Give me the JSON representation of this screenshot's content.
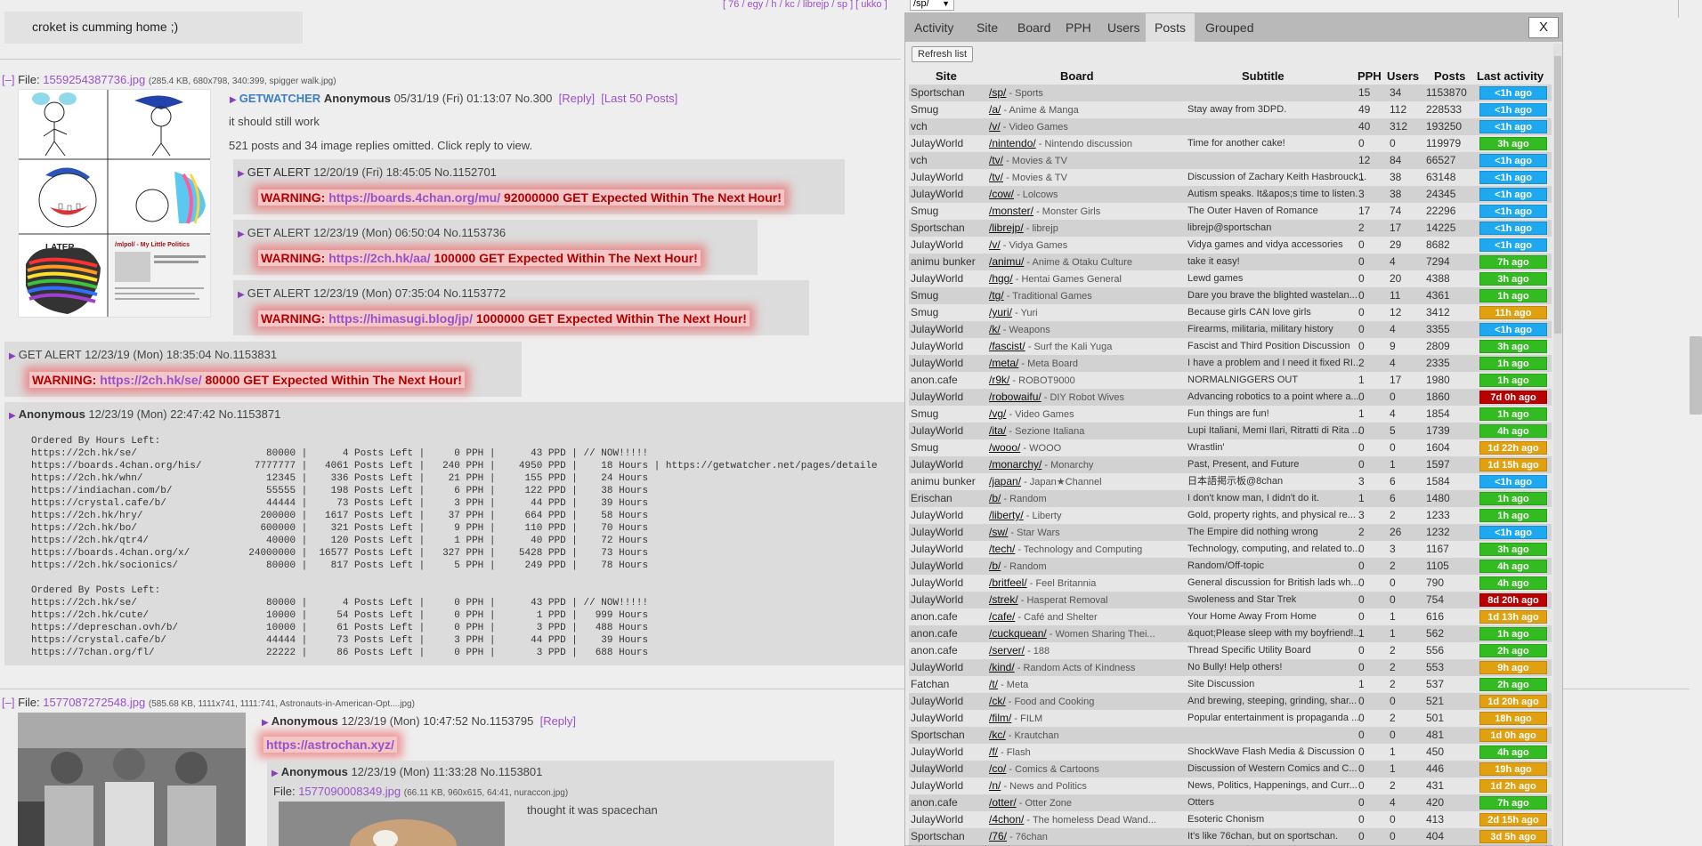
{
  "topnav": {
    "links": "[ 76 / egy / h / kc / librejp / sp ] [ ukko ]",
    "board_select": "/sp/"
  },
  "greybar_text": "croket is cumming home ;)",
  "thread1": {
    "toggle": "[–]",
    "file_label": "File:",
    "file_name": "1559254387736.jpg",
    "file_meta": "(285.4 KB, 680x798, 340:399, spigger walk.jpg)",
    "op_name": "GETWATCHER",
    "op_author": "Anonymous",
    "op_date": "05/31/19 (Fri) 01:13:07",
    "op_no": "No.300",
    "reply_link": "[Reply]",
    "last50_link": "[Last 50 Posts]",
    "op_text": "it should still work",
    "omitted": "521 posts and 34 image replies omitted. Click reply to view.",
    "thumb_caption_1": "LATER",
    "thumb_caption_2": "/mlpol/ - My Little Politics"
  },
  "alerts": [
    {
      "name": "GET ALERT",
      "date": "12/20/19 (Fri) 18:45:05",
      "no": "No.1152701",
      "prefix": "WARNING:",
      "url": "https://boards.4chan.org/mu/",
      "suffix": "92000000 GET Expected Within The Next Hour!"
    },
    {
      "name": "GET ALERT",
      "date": "12/23/19 (Mon) 06:50:04",
      "no": "No.1153736",
      "prefix": "WARNING:",
      "url": "https://2ch.hk/aa/",
      "suffix": "100000 GET Expected Within The Next Hour!"
    },
    {
      "name": "GET ALERT",
      "date": "12/23/19 (Mon) 07:35:04",
      "no": "No.1153772",
      "prefix": "WARNING:",
      "url": "https://himasugi.blog/jp/",
      "suffix": "1000000 GET Expected Within The Next Hour!"
    },
    {
      "name": "GET ALERT",
      "date": "12/23/19 (Mon) 18:35:04",
      "no": "No.1153831",
      "prefix": "WARNING:",
      "url": "https://2ch.hk/se/",
      "suffix": "80000 GET Expected Within The Next Hour!"
    }
  ],
  "anon_post": {
    "author": "Anonymous",
    "date": "12/23/19 (Mon) 22:47:42",
    "no": "No.1153871",
    "body": "Ordered By Hours Left:\nhttps://2ch.hk/se/                      80000 |      4 Posts Left |     0 PPH |      43 PPD | // NOW!!!!!\nhttps://boards.4chan.org/his/         7777777 |   4061 Posts Left |   240 PPH |    4950 PPD |    18 Hours | https://getwatcher.net/pages/detaile\nhttps://2ch.hk/whn/                     12345 |    336 Posts Left |    21 PPH |     155 PPD |    24 Hours\nhttps://indiachan.com/b/                55555 |    198 Posts Left |     6 PPH |     122 PPD |    38 Hours\nhttps://crystal.cafe/b/                 44444 |     73 Posts Left |     3 PPH |      44 PPD |    39 Hours\nhttps://2ch.hk/hry/                    200000 |   1617 Posts Left |    37 PPH |     664 PPD |    58 Hours\nhttps://2ch.hk/bo/                     600000 |    321 Posts Left |     9 PPH |     110 PPD |    70 Hours\nhttps://2ch.hk/qtr4/                    40000 |    120 Posts Left |     1 PPH |      40 PPD |    72 Hours\nhttps://boards.4chan.org/x/          24000000 |  16577 Posts Left |   327 PPH |    5428 PPD |    73 Hours\nhttps://2ch.hk/socionics/               80000 |    817 Posts Left |     5 PPH |     249 PPD |    78 Hours\n\nOrdered By Posts Left:\nhttps://2ch.hk/se/                      80000 |      4 Posts Left |     0 PPH |      43 PPD | // NOW!!!!!\nhttps://2ch.hk/cute/                    10000 |     54 Posts Left |     0 PPH |       1 PPD |   999 Hours\nhttps://depreschan.ovh/b/               10000 |     61 Posts Left |     0 PPH |       3 PPD |   488 Hours\nhttps://crystal.cafe/b/                 44444 |     73 Posts Left |     3 PPH |      44 PPD |    39 Hours\nhttps://7chan.org/fl/                   22222 |     86 Posts Left |     0 PPH |       3 PPD |   688 Hours"
  },
  "thread2": {
    "toggle": "[–]",
    "file_label": "File:",
    "file_name": "1577087272548.jpg",
    "file_meta": "(585.68 KB, 1111x741, 1111:741, Astronauts-in-American-Opt....jpg)",
    "op_author": "Anonymous",
    "op_date": "12/23/19 (Mon) 10:47:52",
    "op_no": "No.1153795",
    "reply_link": "[Reply]",
    "op_link": "https://astrochan.xyz/",
    "reply_author": "Anonymous",
    "reply_date": "12/23/19 (Mon) 11:33:28",
    "reply_no": "No.1153801",
    "reply_file_label": "File:",
    "reply_file": "1577090008349.jpg",
    "reply_file_meta": "(66.11 KB, 960x615, 64:41, nuraccon.jpg)",
    "reply_text": "thought it was spacechan"
  },
  "panel": {
    "tabs": [
      "Activity",
      "Site",
      "Board",
      "PPH",
      "Users",
      "Posts",
      "Grouped"
    ],
    "active_tab": "Posts",
    "close_label": "X",
    "refresh_label": "Refresh list",
    "columns": [
      "Site",
      "Board",
      "Subtitle",
      "PPH",
      "Users",
      "Posts",
      "Last activity"
    ],
    "activity_colors": {
      "cyan": "#1ea8f0",
      "green": "#33bb22",
      "orange": "#e0a010",
      "red": "#b80000"
    },
    "rows": [
      {
        "site": "Sportschan",
        "code": "/sp/",
        "name": " - Sports",
        "sub": "",
        "pph": "15",
        "users": "34",
        "posts": "1153870",
        "act": "<1h ago",
        "color": "cyan"
      },
      {
        "site": "Smug",
        "code": "/a/",
        "name": " - Anime & Manga",
        "sub": "Stay away from 3DPD.",
        "pph": "49",
        "users": "112",
        "posts": "228533",
        "act": "<1h ago",
        "color": "cyan"
      },
      {
        "site": "vch",
        "code": "/v/",
        "name": " - Video Games",
        "sub": "",
        "pph": "40",
        "users": "312",
        "posts": "193250",
        "act": "<1h ago",
        "color": "cyan"
      },
      {
        "site": "JulayWorld",
        "code": "/nintendo/",
        "name": " - Nintendo discussion",
        "sub": "Time for another cake!",
        "pph": "0",
        "users": "0",
        "posts": "119979",
        "act": "3h ago",
        "color": "green"
      },
      {
        "site": "vch",
        "code": "/tv/",
        "name": " - Movies & TV",
        "sub": "",
        "pph": "12",
        "users": "84",
        "posts": "66527",
        "act": "<1h ago",
        "color": "cyan"
      },
      {
        "site": "JulayWorld",
        "code": "/tv/",
        "name": " - Movies & TV",
        "sub": "Discussion of Zachary Keith Hasbrouck...",
        "pph": "1",
        "users": "38",
        "posts": "63148",
        "act": "<1h ago",
        "color": "cyan"
      },
      {
        "site": "JulayWorld",
        "code": "/cow/",
        "name": " - Lolcows",
        "sub": "Autism speaks. It&apos;s time to listen.",
        "pph": "3",
        "users": "38",
        "posts": "24345",
        "act": "<1h ago",
        "color": "cyan"
      },
      {
        "site": "Smug",
        "code": "/monster/",
        "name": " - Monster Girls",
        "sub": "The Outer Haven of Romance",
        "pph": "17",
        "users": "74",
        "posts": "22296",
        "act": "<1h ago",
        "color": "cyan"
      },
      {
        "site": "Sportschan",
        "code": "/librejp/",
        "name": " - librejp",
        "sub": "librejp@sportschan",
        "pph": "2",
        "users": "17",
        "posts": "14225",
        "act": "<1h ago",
        "color": "cyan"
      },
      {
        "site": "JulayWorld",
        "code": "/v/",
        "name": " - Vidya Games",
        "sub": "Vidya games and vidya accessories",
        "pph": "0",
        "users": "29",
        "posts": "8682",
        "act": "<1h ago",
        "color": "cyan"
      },
      {
        "site": "animu bunker",
        "code": "/animu/",
        "name": " - Anime & Otaku Culture",
        "sub": "take it easy!",
        "pph": "0",
        "users": "4",
        "posts": "7294",
        "act": "7h ago",
        "color": "green"
      },
      {
        "site": "JulayWorld",
        "code": "/hgg/",
        "name": " - Hentai Games General",
        "sub": "Lewd games",
        "pph": "0",
        "users": "20",
        "posts": "4388",
        "act": "3h ago",
        "color": "green"
      },
      {
        "site": "Smug",
        "code": "/tg/",
        "name": " - Traditional Games",
        "sub": "Dare you brave the blighted wastelan...",
        "pph": "0",
        "users": "11",
        "posts": "4361",
        "act": "1h ago",
        "color": "green"
      },
      {
        "site": "Smug",
        "code": "/yuri/",
        "name": " - Yuri",
        "sub": "Because girls CAN love girls",
        "pph": "0",
        "users": "12",
        "posts": "3412",
        "act": "11h ago",
        "color": "orange"
      },
      {
        "site": "JulayWorld",
        "code": "/k/",
        "name": " - Weapons",
        "sub": "Firearms, militaria, military history",
        "pph": "0",
        "users": "4",
        "posts": "3355",
        "act": "<1h ago",
        "color": "cyan"
      },
      {
        "site": "JulayWorld",
        "code": "/fascist/",
        "name": " - Surf the Kali Yuga",
        "sub": "Fascist and Third Position Discussion",
        "pph": "0",
        "users": "9",
        "posts": "2809",
        "act": "3h ago",
        "color": "green"
      },
      {
        "site": "JulayWorld",
        "code": "/meta/",
        "name": " - Meta Board",
        "sub": "I have a problem and I need it fixed RI...",
        "pph": "2",
        "users": "4",
        "posts": "2335",
        "act": "1h ago",
        "color": "green"
      },
      {
        "site": "anon.cafe",
        "code": "/r9k/",
        "name": " - ROBOT9000",
        "sub": "NORMALNIGGERS OUT",
        "pph": "1",
        "users": "17",
        "posts": "1980",
        "act": "1h ago",
        "color": "green"
      },
      {
        "site": "JulayWorld",
        "code": "/robowaifu/",
        "name": " - DIY Robot Wives",
        "sub": "Advancing robotics to a point where a...",
        "pph": "0",
        "users": "0",
        "posts": "1860",
        "act": "7d 0h ago",
        "color": "red"
      },
      {
        "site": "Smug",
        "code": "/vg/",
        "name": " - Video Games",
        "sub": "Fun things are fun!",
        "pph": "1",
        "users": "4",
        "posts": "1854",
        "act": "1h ago",
        "color": "green"
      },
      {
        "site": "JulayWorld",
        "code": "/ita/",
        "name": " - Sezione Italiana",
        "sub": "Lupi Italiani, Memi Ilari, Ritratti di Rita ...",
        "pph": "0",
        "users": "5",
        "posts": "1739",
        "act": "4h ago",
        "color": "green"
      },
      {
        "site": "Smug",
        "code": "/wooo/",
        "name": " - WOOO",
        "sub": "Wrastlin'",
        "pph": "0",
        "users": "0",
        "posts": "1604",
        "act": "1d 22h ago",
        "color": "orange"
      },
      {
        "site": "JulayWorld",
        "code": "/monarchy/",
        "name": " - Monarchy",
        "sub": "Past, Present, and Future",
        "pph": "0",
        "users": "1",
        "posts": "1597",
        "act": "1d 15h ago",
        "color": "orange"
      },
      {
        "site": "animu bunker",
        "code": "/japan/",
        "name": " - Japan★Channel",
        "sub": "日本語掲示板@8chan",
        "pph": "3",
        "users": "6",
        "posts": "1584",
        "act": "<1h ago",
        "color": "cyan"
      },
      {
        "site": "Erischan",
        "code": "/b/",
        "name": " - Random",
        "sub": "I don't know man, I didn't do it.",
        "pph": "1",
        "users": "6",
        "posts": "1480",
        "act": "1h ago",
        "color": "green"
      },
      {
        "site": "JulayWorld",
        "code": "/liberty/",
        "name": " - Liberty",
        "sub": "Gold, property rights, and physical re...",
        "pph": "3",
        "users": "2",
        "posts": "1233",
        "act": "1h ago",
        "color": "green"
      },
      {
        "site": "JulayWorld",
        "code": "/sw/",
        "name": " - Star Wars",
        "sub": "The Empire did nothing wrong",
        "pph": "2",
        "users": "26",
        "posts": "1232",
        "act": "<1h ago",
        "color": "cyan"
      },
      {
        "site": "JulayWorld",
        "code": "/tech/",
        "name": " - Technology and Computing",
        "sub": "Technology, computing, and related to...",
        "pph": "0",
        "users": "3",
        "posts": "1167",
        "act": "3h ago",
        "color": "green"
      },
      {
        "site": "JulayWorld",
        "code": "/b/",
        "name": " - Random",
        "sub": "Random/Off-topic",
        "pph": "0",
        "users": "2",
        "posts": "1105",
        "act": "4h ago",
        "color": "green"
      },
      {
        "site": "JulayWorld",
        "code": "/britfeel/",
        "name": " - Feel Britannia",
        "sub": "General discussion for British lads wh...",
        "pph": "0",
        "users": "0",
        "posts": "790",
        "act": "4h ago",
        "color": "green"
      },
      {
        "site": "JulayWorld",
        "code": "/strek/",
        "name": " - Hasperat Removal",
        "sub": "Swoleness and Star Trek",
        "pph": "0",
        "users": "0",
        "posts": "754",
        "act": "8d 20h ago",
        "color": "red"
      },
      {
        "site": "anon.cafe",
        "code": "/cafe/",
        "name": " - Café and Shelter",
        "sub": "Your Home Away From Home",
        "pph": "0",
        "users": "1",
        "posts": "616",
        "act": "1d 13h ago",
        "color": "orange"
      },
      {
        "site": "anon.cafe",
        "code": "/cuckquean/",
        "name": " - Women Sharing Thei...",
        "sub": "&quot;Please sleep with my boyfriend!...",
        "pph": "1",
        "users": "1",
        "posts": "562",
        "act": "1h ago",
        "color": "green"
      },
      {
        "site": "anon.cafe",
        "code": "/server/",
        "name": " - 188",
        "sub": "Thread Specific Utility Board",
        "pph": "0",
        "users": "2",
        "posts": "556",
        "act": "2h ago",
        "color": "green"
      },
      {
        "site": "JulayWorld",
        "code": "/kind/",
        "name": " - Random Acts of Kindness",
        "sub": "No Bully! Help others!",
        "pph": "0",
        "users": "2",
        "posts": "553",
        "act": "9h ago",
        "color": "orange"
      },
      {
        "site": "Fatchan",
        "code": "/t/",
        "name": " - Meta",
        "sub": "Site Discussion",
        "pph": "1",
        "users": "2",
        "posts": "537",
        "act": "2h ago",
        "color": "green"
      },
      {
        "site": "JulayWorld",
        "code": "/ck/",
        "name": " - Food and Cooking",
        "sub": "And brewing, steeping, grinding, shar...",
        "pph": "0",
        "users": "0",
        "posts": "521",
        "act": "1d 20h ago",
        "color": "orange"
      },
      {
        "site": "JulayWorld",
        "code": "/film/",
        "name": " - FILM",
        "sub": "Popular entertainment is propaganda ...",
        "pph": "0",
        "users": "2",
        "posts": "501",
        "act": "18h ago",
        "color": "orange"
      },
      {
        "site": "Sportschan",
        "code": "/kc/",
        "name": " - Krautchan",
        "sub": "",
        "pph": "0",
        "users": "0",
        "posts": "481",
        "act": "1d 0h ago",
        "color": "orange"
      },
      {
        "site": "JulayWorld",
        "code": "/f/",
        "name": " - Flash",
        "sub": "ShockWave Flash Media & Discussion",
        "pph": "0",
        "users": "1",
        "posts": "450",
        "act": "4h ago",
        "color": "green"
      },
      {
        "site": "JulayWorld",
        "code": "/co/",
        "name": " - Comics & Cartoons",
        "sub": "Discussion of Western Comics and C...",
        "pph": "0",
        "users": "1",
        "posts": "446",
        "act": "19h ago",
        "color": "orange"
      },
      {
        "site": "JulayWorld",
        "code": "/n/",
        "name": " - News and Politics",
        "sub": "News, Politics, Happenings, and Curr...",
        "pph": "0",
        "users": "2",
        "posts": "431",
        "act": "1d 2h ago",
        "color": "orange"
      },
      {
        "site": "anon.cafe",
        "code": "/otter/",
        "name": " - Otter Zone",
        "sub": "Otters",
        "pph": "0",
        "users": "4",
        "posts": "420",
        "act": "7h ago",
        "color": "green"
      },
      {
        "site": "JulayWorld",
        "code": "/4chon/",
        "name": " - The homeless Dead Wand...",
        "sub": "Esoteric Chonism",
        "pph": "0",
        "users": "0",
        "posts": "413",
        "act": "2d 15h ago",
        "color": "orange"
      },
      {
        "site": "Sportschan",
        "code": "/76/",
        "name": " - 76chan",
        "sub": "It's like 76chan, but on sportschan.",
        "pph": "0",
        "users": "0",
        "posts": "404",
        "act": "3d 5h ago",
        "color": "orange"
      }
    ]
  }
}
